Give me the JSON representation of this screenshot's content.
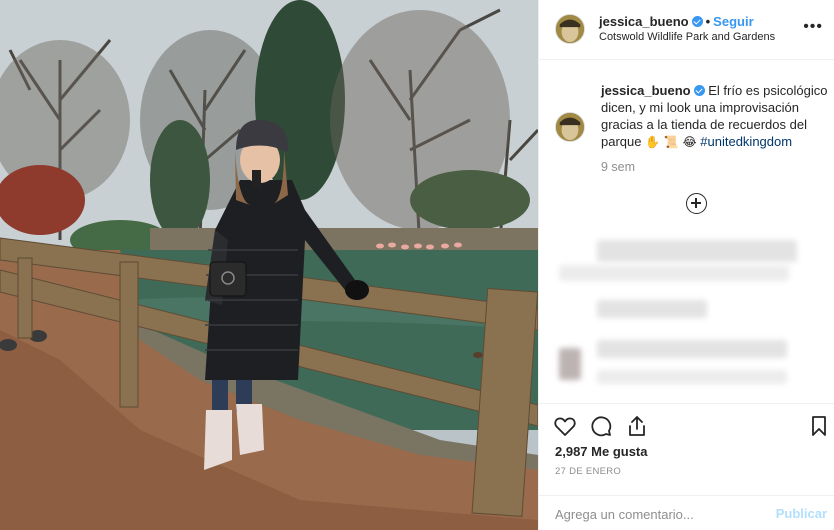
{
  "post": {
    "author": "jessica_bueno",
    "follow_label": "Seguir",
    "location": "Cotswold Wildlife Park and Gardens",
    "more_icon": "more-options-icon",
    "caption": {
      "author": "jessica_bueno",
      "text": "El frío es psicológico dicen, y mi look una improvisación gracias a la tienda de recuerdos del parque",
      "emojis": "✋ 📜 😂",
      "hashtag": "#unitedkingdom"
    },
    "time_ago": "9 sem",
    "likes_label": "2,987 Me gusta",
    "date": "27 DE ENERO",
    "comment_placeholder": "Agrega un comentario...",
    "publish_label": "Publicar"
  },
  "colors": {
    "link_blue": "#3897f0",
    "hashtag_blue": "#00376b",
    "muted": "#8e8e8e",
    "publish_disabled": "#b2dffc"
  },
  "icons": [
    "heart-icon",
    "comment-icon",
    "share-icon",
    "bookmark-icon",
    "plus-circle-icon",
    "verified-badge-icon"
  ]
}
